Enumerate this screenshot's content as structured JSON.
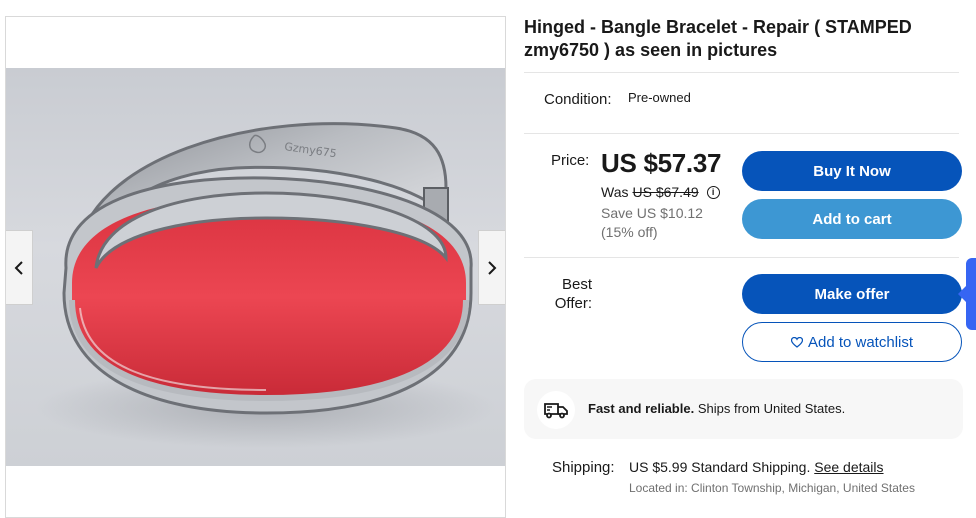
{
  "listing": {
    "title": "Hinged - Bangle Bracelet - Repair ( STAMPED zmy6750 ) as seen in pictures"
  },
  "gallery": {
    "prev_icon": "chevron-left-icon",
    "next_icon": "chevron-right-icon",
    "engraving": "Gzmy675"
  },
  "condition": {
    "label": "Condition:",
    "value": "Pre-owned"
  },
  "price": {
    "label": "Price:",
    "current": "US $57.37",
    "was_label": "Was",
    "was_value": "US $67.49",
    "save_text": "Save US $10.12 (15% off)"
  },
  "buttons": {
    "buy_now": "Buy It Now",
    "add_to_cart": "Add to cart",
    "make_offer": "Make offer",
    "add_to_watchlist": "Add to watchlist"
  },
  "best_offer": {
    "label_line1": "Best",
    "label_line2": "Offer:"
  },
  "shipping_banner": {
    "bold": "Fast and reliable.",
    "text": "Ships from United States."
  },
  "shipping": {
    "label": "Shipping:",
    "cost": "US $5.99",
    "method": "Standard Shipping.",
    "details_link": "See details",
    "located_in": "Located in: Clinton Township, Michigan, United States"
  },
  "colors": {
    "primary_button": "#0654ba",
    "secondary_button": "#3d97d3",
    "bracelet_red": "#e63a45"
  }
}
